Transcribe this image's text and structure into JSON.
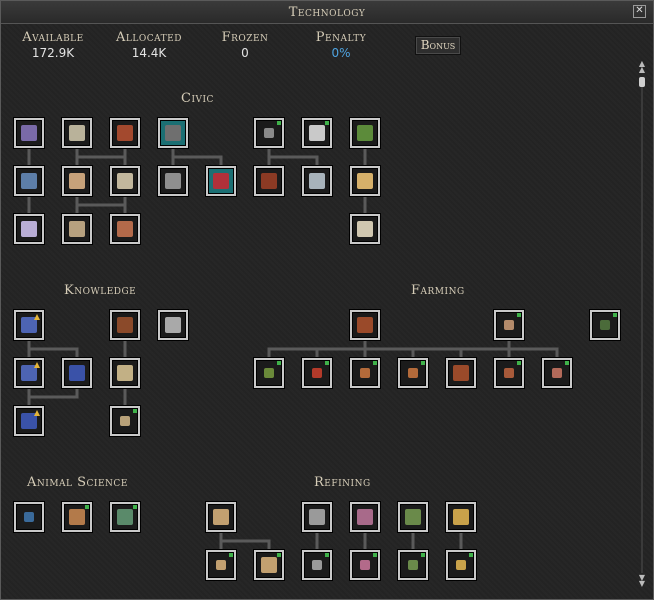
{
  "window": {
    "title": "Technology",
    "close_icon": "close-icon"
  },
  "stats": [
    {
      "label": "Available",
      "value": "172.9K",
      "accent": "#e4e4e4"
    },
    {
      "label": "Allocated",
      "value": "14.4K",
      "accent": "#e4e4e4"
    },
    {
      "label": "Frozen",
      "value": "0",
      "accent": "#e4e4e4"
    },
    {
      "label": "Penalty",
      "value": "0%",
      "accent": "#4ea3e0"
    }
  ],
  "bonus_button": {
    "label": "Bonus"
  },
  "sections": {
    "civic": {
      "title": "Civic"
    },
    "knowledge": {
      "title": "Knowledge"
    },
    "farming": {
      "title": "Farming"
    },
    "animal_science": {
      "title": "Animal Science"
    },
    "refining": {
      "title": "Refining"
    }
  },
  "colors": {
    "node_border": "#c9c9c9",
    "node_selected": "#1b6f73",
    "ready_marker": "#3fb24a",
    "upgrade_arrow": "#e6b638"
  },
  "nodes": [
    {
      "id": "civic-1",
      "icon": "scroll-desk-icon",
      "color": "#7a6aa8"
    },
    {
      "id": "civic-2",
      "icon": "ledger-icon",
      "color": "#b9b29a"
    },
    {
      "id": "civic-3",
      "icon": "shield-icon",
      "color": "#a3492e"
    },
    {
      "id": "civic-4",
      "icon": "helmet-icon",
      "color": "#6f6f6f",
      "selected": true
    },
    {
      "id": "civic-5",
      "icon": "coin-icon",
      "color": "#8a8a8a"
    },
    {
      "id": "civic-6",
      "icon": "ore-icon",
      "color": "#c9c9c9"
    },
    {
      "id": "civic-7",
      "icon": "bell-icon",
      "color": "#5c8b3a"
    },
    {
      "id": "civic-8",
      "icon": "map-icon",
      "color": "#5d7ea8"
    },
    {
      "id": "civic-9",
      "icon": "bust-icon",
      "color": "#c7a27a"
    },
    {
      "id": "civic-10",
      "icon": "scroll-icon",
      "color": "#c2b79d"
    },
    {
      "id": "civic-11",
      "icon": "arch-icon",
      "color": "#8f8f8f"
    },
    {
      "id": "civic-12",
      "icon": "banner-icon",
      "color": "#b0303a",
      "selected": true
    },
    {
      "id": "civic-13",
      "icon": "wreath-icon",
      "color": "#8b3a24"
    },
    {
      "id": "civic-14",
      "icon": "jug-icon",
      "color": "#a8b3bb"
    },
    {
      "id": "civic-15",
      "icon": "temple-icon",
      "color": "#d6b06a"
    },
    {
      "id": "civic-16",
      "icon": "robe-icon",
      "color": "#b9aed6"
    },
    {
      "id": "civic-17",
      "icon": "medallion-icon",
      "color": "#b7a17f"
    },
    {
      "id": "civic-18",
      "icon": "hammer-icon",
      "color": "#b36a4a"
    },
    {
      "id": "civic-19",
      "icon": "pillar-icon",
      "color": "#d0c7b0"
    },
    {
      "id": "knowledge-1",
      "icon": "flask-icon",
      "color": "#4d64b3",
      "upgrade": true
    },
    {
      "id": "knowledge-2",
      "icon": "chalkboard-icon",
      "color": "#8b4a2a"
    },
    {
      "id": "knowledge-3",
      "icon": "academy-icon",
      "color": "#a9a9a9"
    },
    {
      "id": "knowledge-4",
      "icon": "flask-icon",
      "color": "#4d64b3",
      "upgrade": true
    },
    {
      "id": "knowledge-5",
      "icon": "book-icon",
      "color": "#3a52a8"
    },
    {
      "id": "knowledge-6",
      "icon": "map-scroll-icon",
      "color": "#c2b085"
    },
    {
      "id": "knowledge-7",
      "icon": "tome-icon",
      "color": "#3a52a8",
      "upgrade": true
    },
    {
      "id": "knowledge-8",
      "icon": "wax-seal-icon",
      "color": "#b9a27a"
    },
    {
      "id": "farming-1",
      "icon": "crops-icon",
      "color": "#9a4a2a"
    },
    {
      "id": "farming-2",
      "icon": "seed-sacks-icon",
      "color": "#b38a6a"
    },
    {
      "id": "farming-3",
      "icon": "orchard-icon",
      "color": "#4b6b3a"
    },
    {
      "id": "farming-4",
      "icon": "wheat-icon",
      "color": "#6b8a3a"
    },
    {
      "id": "farming-5",
      "icon": "berry-icon",
      "color": "#b33a2a"
    },
    {
      "id": "farming-6",
      "icon": "grain-icon",
      "color": "#b36a3a"
    },
    {
      "id": "farming-7",
      "icon": "gourd-icon",
      "color": "#b36a3a"
    },
    {
      "id": "farming-8",
      "icon": "vegetables-icon",
      "color": "#9a4a2a"
    },
    {
      "id": "farming-9",
      "icon": "spice-icon",
      "color": "#a85a3a"
    },
    {
      "id": "farming-10",
      "icon": "sack-icon",
      "color": "#b36a5a"
    },
    {
      "id": "animal-1",
      "icon": "livestock-icon",
      "color": "#3a6a9a"
    },
    {
      "id": "animal-2",
      "icon": "pasture-icon",
      "color": "#b37a4a"
    },
    {
      "id": "animal-3",
      "icon": "fodder-icon",
      "color": "#5a8a6a"
    },
    {
      "id": "refining-1",
      "icon": "cart-icon",
      "color": "#c2a070"
    },
    {
      "id": "refining-2",
      "icon": "workshop-icon",
      "color": "#9a9a9a"
    },
    {
      "id": "refining-3",
      "icon": "loom-icon",
      "color": "#a86a8a"
    },
    {
      "id": "refining-4",
      "icon": "tree-cutting-icon",
      "color": "#6a8a4a"
    },
    {
      "id": "refining-5",
      "icon": "anvil-icon",
      "color": "#c9a24a"
    },
    {
      "id": "refining-6",
      "icon": "bread-icon",
      "color": "#c2a070"
    },
    {
      "id": "refining-7",
      "icon": "basket-icon",
      "color": "#c2a070"
    },
    {
      "id": "refining-8",
      "icon": "mill-icon",
      "color": "#9a9a9a"
    },
    {
      "id": "refining-9",
      "icon": "dye-icon",
      "color": "#b36a8a"
    },
    {
      "id": "refining-10",
      "icon": "lumber-icon",
      "color": "#6a8a4a"
    },
    {
      "id": "refining-11",
      "icon": "ingot-icon",
      "color": "#c9a24a"
    }
  ]
}
